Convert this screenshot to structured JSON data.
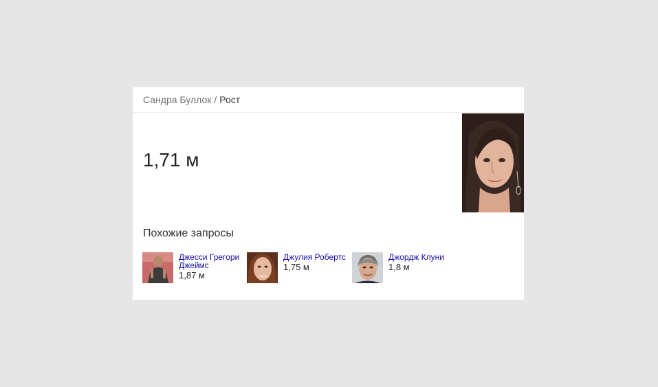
{
  "breadcrumb": {
    "person": "Сандра Буллок",
    "separator": "/",
    "attribute": "Рост"
  },
  "answer": {
    "value": "1,71 м"
  },
  "main_photo": {
    "icon": "person-portrait-icon"
  },
  "related": {
    "title": "Похожие запросы",
    "items": [
      {
        "name": "Джесси Грегори Джеймс",
        "value": "1,87 м",
        "icon": "person-thumbnail-icon"
      },
      {
        "name": "Джулия Робертс",
        "value": "1,75 м",
        "icon": "person-thumbnail-icon"
      },
      {
        "name": "Джордж Клуни",
        "value": "1,8 м",
        "icon": "person-thumbnail-icon"
      }
    ]
  },
  "colors": {
    "page_background": "#e6e6e6",
    "card_background": "#ffffff",
    "link": "#1a0dab",
    "muted_text": "#6f6f6f"
  }
}
